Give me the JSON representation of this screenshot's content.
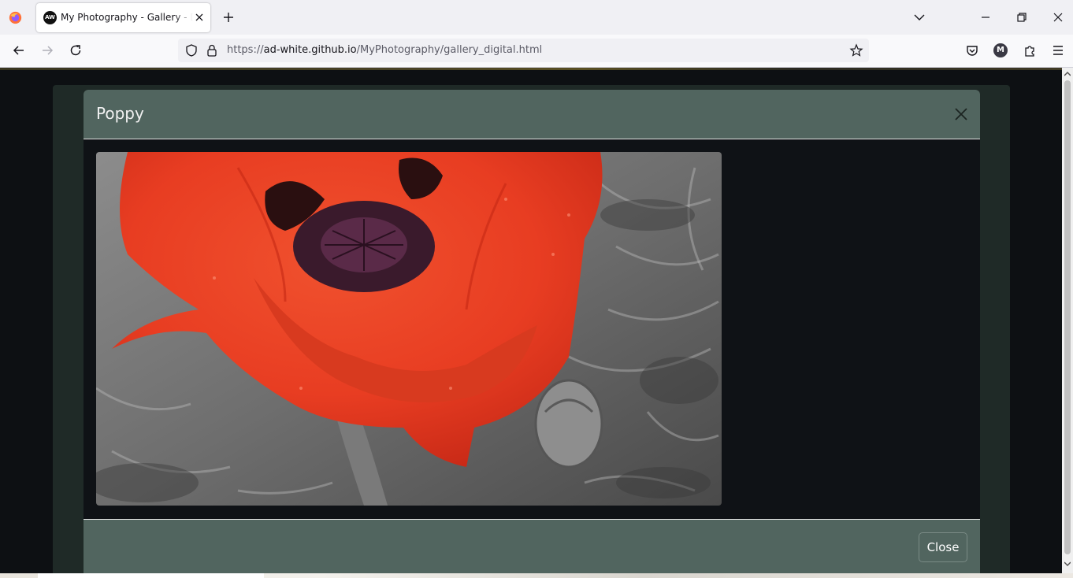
{
  "browser": {
    "tab": {
      "favicon_text": "AW",
      "title": "My Photography - Gallery - Digital"
    },
    "url": {
      "prefix": "https://",
      "host": "ad-white.github.io",
      "path": "/MyPhotography/gallery_digital.html"
    },
    "account_initial": "M"
  },
  "modal": {
    "title": "Poppy",
    "close_label": "Close"
  },
  "colors": {
    "modal_bar": "#51655f",
    "modal_body": "#0f1216",
    "poppy_red": "#e8402a"
  }
}
